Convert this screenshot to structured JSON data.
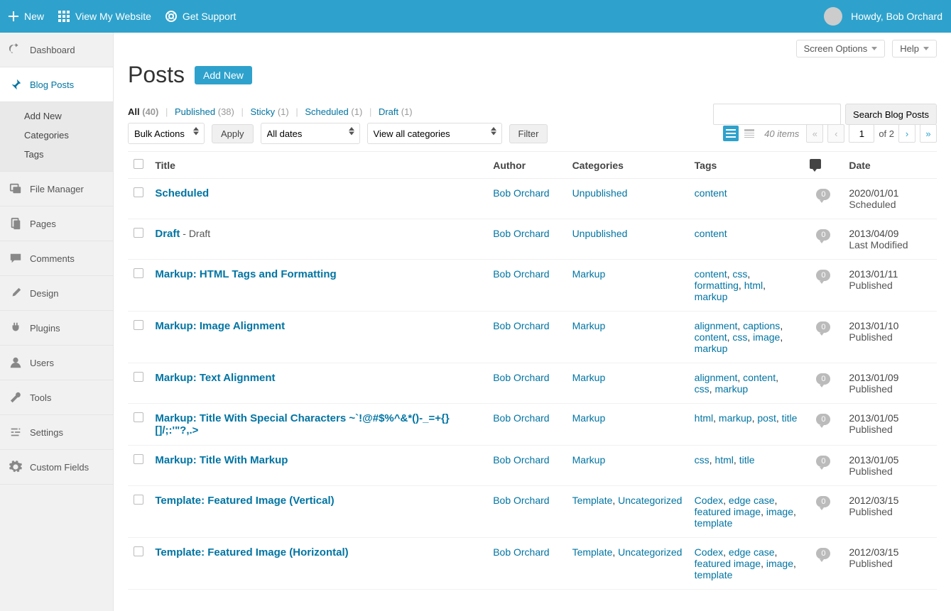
{
  "topbar": {
    "new": "New",
    "view_site": "View My Website",
    "support": "Get Support",
    "howdy": "Howdy, Bob Orchard"
  },
  "sidebar": {
    "dashboard": "Dashboard",
    "blog_posts": "Blog Posts",
    "sub_add_new": "Add New",
    "sub_categories": "Categories",
    "sub_tags": "Tags",
    "file_manager": "File Manager",
    "pages": "Pages",
    "comments": "Comments",
    "design": "Design",
    "plugins": "Plugins",
    "users": "Users",
    "tools": "Tools",
    "settings": "Settings",
    "custom_fields": "Custom Fields"
  },
  "actions": {
    "screen_options": "Screen Options",
    "help": "Help"
  },
  "page": {
    "title": "Posts",
    "add_new": "Add New"
  },
  "filters": {
    "all_label": "All",
    "all_count": "(40)",
    "published_label": "Published",
    "published_count": "(38)",
    "sticky_label": "Sticky",
    "sticky_count": "(1)",
    "scheduled_label": "Scheduled",
    "scheduled_count": "(1)",
    "draft_label": "Draft",
    "draft_count": "(1)"
  },
  "toolbar": {
    "bulk_actions": "Bulk Actions",
    "apply": "Apply",
    "all_dates": "All dates",
    "view_all_categories": "View all categories",
    "filter": "Filter",
    "search_btn": "Search Blog Posts",
    "items_count": "40 items",
    "page_current": "1",
    "page_of": "of 2"
  },
  "columns": {
    "title": "Title",
    "author": "Author",
    "categories": "Categories",
    "tags": "Tags",
    "date": "Date"
  },
  "rows": [
    {
      "title": "Scheduled",
      "suffix": "",
      "author": "Bob Orchard",
      "categories": "Unpublished",
      "tags": "content",
      "comments": "0",
      "date": "2020/01/01",
      "status": "Scheduled"
    },
    {
      "title": "Draft",
      "suffix": " - Draft",
      "author": "Bob Orchard",
      "categories": "Unpublished",
      "tags": "content",
      "comments": "0",
      "date": "2013/04/09",
      "status": "Last Modified"
    },
    {
      "title": "Markup: HTML Tags and Formatting",
      "suffix": "",
      "author": "Bob Orchard",
      "categories": "Markup",
      "tags": "content, css, formatting, html, markup",
      "comments": "0",
      "date": "2013/01/11",
      "status": "Published"
    },
    {
      "title": "Markup: Image Alignment",
      "suffix": "",
      "author": "Bob Orchard",
      "categories": "Markup",
      "tags": "alignment, captions, content, css, image, markup",
      "comments": "0",
      "date": "2013/01/10",
      "status": "Published"
    },
    {
      "title": "Markup: Text Alignment",
      "suffix": "",
      "author": "Bob Orchard",
      "categories": "Markup",
      "tags": "alignment, content, css, markup",
      "comments": "0",
      "date": "2013/01/09",
      "status": "Published"
    },
    {
      "title": "Markup: Title With Special Characters ~`!@#$%^&*()-_=+{}[]/;:'\"?,.>",
      "suffix": "",
      "author": "Bob Orchard",
      "categories": "Markup",
      "tags": "html, markup, post, title",
      "comments": "0",
      "date": "2013/01/05",
      "status": "Published"
    },
    {
      "title": "Markup: Title With Markup",
      "suffix": "",
      "author": "Bob Orchard",
      "categories": "Markup",
      "tags": "css, html, title",
      "comments": "0",
      "date": "2013/01/05",
      "status": "Published"
    },
    {
      "title": "Template: Featured Image (Vertical)",
      "suffix": "",
      "author": "Bob Orchard",
      "categories": "Template, Uncategorized",
      "tags": "Codex, edge case, featured image, image, template",
      "comments": "0",
      "date": "2012/03/15",
      "status": "Published"
    },
    {
      "title": "Template: Featured Image (Horizontal)",
      "suffix": "",
      "author": "Bob Orchard",
      "categories": "Template, Uncategorized",
      "tags": "Codex, edge case, featured image, image, template",
      "comments": "0",
      "date": "2012/03/15",
      "status": "Published"
    }
  ]
}
